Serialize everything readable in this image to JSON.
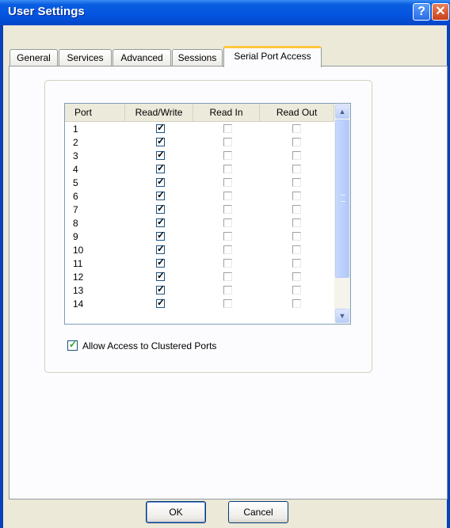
{
  "window": {
    "title": "User Settings"
  },
  "tabs": [
    "General",
    "Services",
    "Advanced",
    "Sessions",
    "Serial Port Access"
  ],
  "list": {
    "columns": [
      "Port",
      "Read/Write",
      "Read In",
      "Read Out"
    ],
    "rows": [
      {
        "port": "1",
        "rw": true,
        "ri": false,
        "ro": false
      },
      {
        "port": "2",
        "rw": true,
        "ri": false,
        "ro": false
      },
      {
        "port": "3",
        "rw": true,
        "ri": false,
        "ro": false
      },
      {
        "port": "4",
        "rw": true,
        "ri": false,
        "ro": false
      },
      {
        "port": "5",
        "rw": true,
        "ri": false,
        "ro": false
      },
      {
        "port": "6",
        "rw": true,
        "ri": false,
        "ro": false
      },
      {
        "port": "7",
        "rw": true,
        "ri": false,
        "ro": false
      },
      {
        "port": "8",
        "rw": true,
        "ri": false,
        "ro": false
      },
      {
        "port": "9",
        "rw": true,
        "ri": false,
        "ro": false
      },
      {
        "port": "10",
        "rw": true,
        "ri": false,
        "ro": false
      },
      {
        "port": "11",
        "rw": true,
        "ri": false,
        "ro": false
      },
      {
        "port": "12",
        "rw": true,
        "ri": false,
        "ro": false
      },
      {
        "port": "13",
        "rw": true,
        "ri": false,
        "ro": false
      },
      {
        "port": "14",
        "rw": true,
        "ri": false,
        "ro": false
      }
    ]
  },
  "options": {
    "allow_clustered_label": "Allow Access to Clustered Ports",
    "allow_clustered_checked": true
  },
  "buttons": {
    "ok": "OK",
    "cancel": "Cancel"
  }
}
